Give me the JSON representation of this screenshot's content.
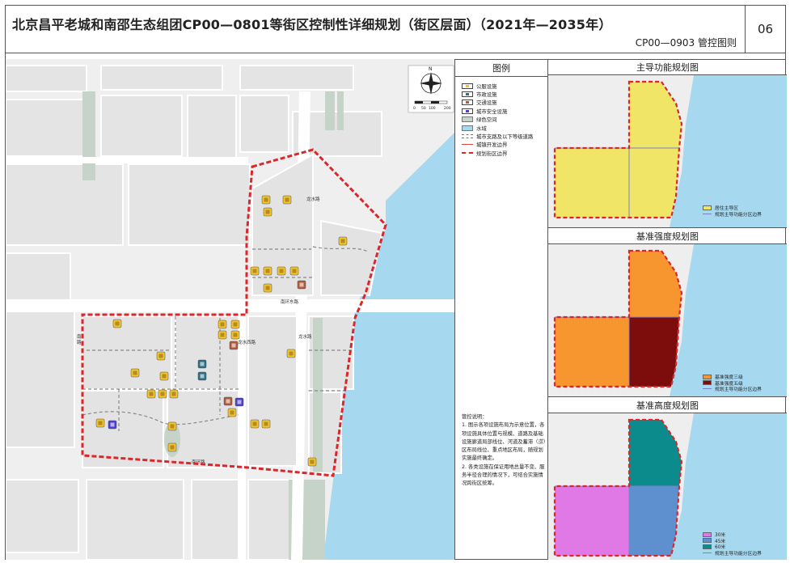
{
  "header": {
    "title": "北京昌平老城和南邵生态组团CP00—0801等街区控制性详细规划（街区层面）（2021年—2035年）",
    "subtitle": "CP00—0903  管控图则",
    "page_number": "06"
  },
  "map": {
    "north_label": "N",
    "scale_labels": [
      "0",
      "50",
      "100",
      "200"
    ],
    "road_labels": {
      "longshui_road": "龙水路",
      "nanhuan_east_road": "南环东路",
      "longshui_road_2": "龙水路",
      "longshui_west_road": "龙水西路",
      "road_west_1": "南",
      "road_west_2": "路",
      "south_road": "南环路"
    },
    "colors": {
      "water": "#a6d8f0",
      "block": "#e3e3e3",
      "green": "#c5d3c9",
      "boundary": "#d9272c",
      "public_facility": "#f2c230",
      "municipal_facility": "#2b6e86",
      "traffic_facility": "#b05a3c",
      "safety_facility": "#4b3fd1"
    }
  },
  "legend": {
    "title": "图例",
    "items": [
      {
        "key": "pub",
        "label": "公服设施"
      },
      {
        "key": "city",
        "label": "市政设施"
      },
      {
        "key": "traf",
        "label": "交通设施"
      },
      {
        "key": "safe",
        "label": "城市安全设施"
      },
      {
        "key": "green",
        "label": "绿色空间"
      },
      {
        "key": "water",
        "label": "水域"
      },
      {
        "key": "road",
        "label": "城市支路及以下等级道路"
      },
      {
        "key": "urban",
        "label": "城镇开发边界"
      },
      {
        "key": "block",
        "label": "规划街区边界"
      }
    ],
    "notes_title": "管控说明：",
    "notes": [
      "1. 图示各项设施布局为示意位置，各项设施具体位置与规模、道路及基础设施廊道局部线位、河道及蓄滞（涝）区布局线位、重点地区布局，随规划实施最终确定。",
      "2. 各类设施在保证用地总量不变、服务半径合理的情况下，可结合实施情况跨街区统筹。"
    ]
  },
  "panels": {
    "function": {
      "title": "主导功能规划图",
      "legend": [
        {
          "label": "居住主导区",
          "color": "#f0e567"
        },
        {
          "label": "规划主导功能分区边界",
          "line": true
        }
      ]
    },
    "intensity": {
      "title": "基准强度规划图",
      "legend": [
        {
          "label": "基准强度三级",
          "color": "#f7952e"
        },
        {
          "label": "基准强度五级",
          "color": "#7d0d0d"
        },
        {
          "label": "规划主导功能分区边界",
          "line": true
        }
      ]
    },
    "height": {
      "title": "基准高度规划图",
      "legend": [
        {
          "label": "30米",
          "color": "#e079e6"
        },
        {
          "label": "45米",
          "color": "#5e8fcf"
        },
        {
          "label": "60米",
          "color": "#0b8b8b"
        },
        {
          "label": "规划主导功能分区边界",
          "line": true
        }
      ]
    }
  }
}
